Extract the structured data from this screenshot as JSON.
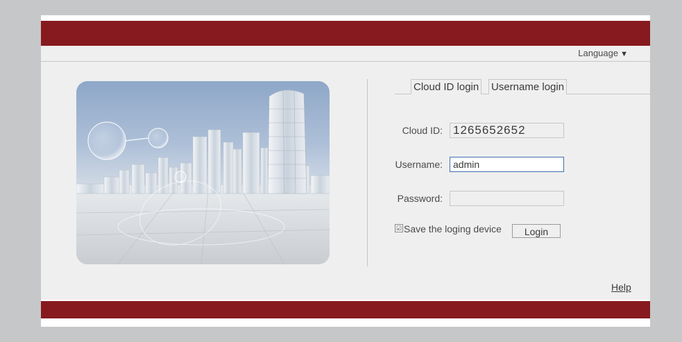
{
  "header": {
    "language_label": "Language",
    "language_caret": "▼"
  },
  "tabs": {
    "cloud_id_login": "Cloud ID login",
    "username_login": "Username login",
    "active": "cloud_id_login"
  },
  "form": {
    "cloud_id_label": "Cloud ID:",
    "cloud_id_value": "1265652652",
    "username_label": "Username:",
    "username_value": "admin",
    "password_label": "Password:",
    "password_value": "",
    "save_device_label": "Save the loging device",
    "save_device_checked": true,
    "checkbox_glyph": "☑",
    "login_button": "Login"
  },
  "footer": {
    "help_link": "Help"
  },
  "colors": {
    "brand_bar": "#861a1f",
    "panel_background": "#efefef",
    "page_background": "#c6c7c8",
    "focused_field_border": "#3f6fb0"
  },
  "icons": {
    "language_caret": "caret-down-icon",
    "save_checkbox": "checkbox-checked-icon"
  }
}
